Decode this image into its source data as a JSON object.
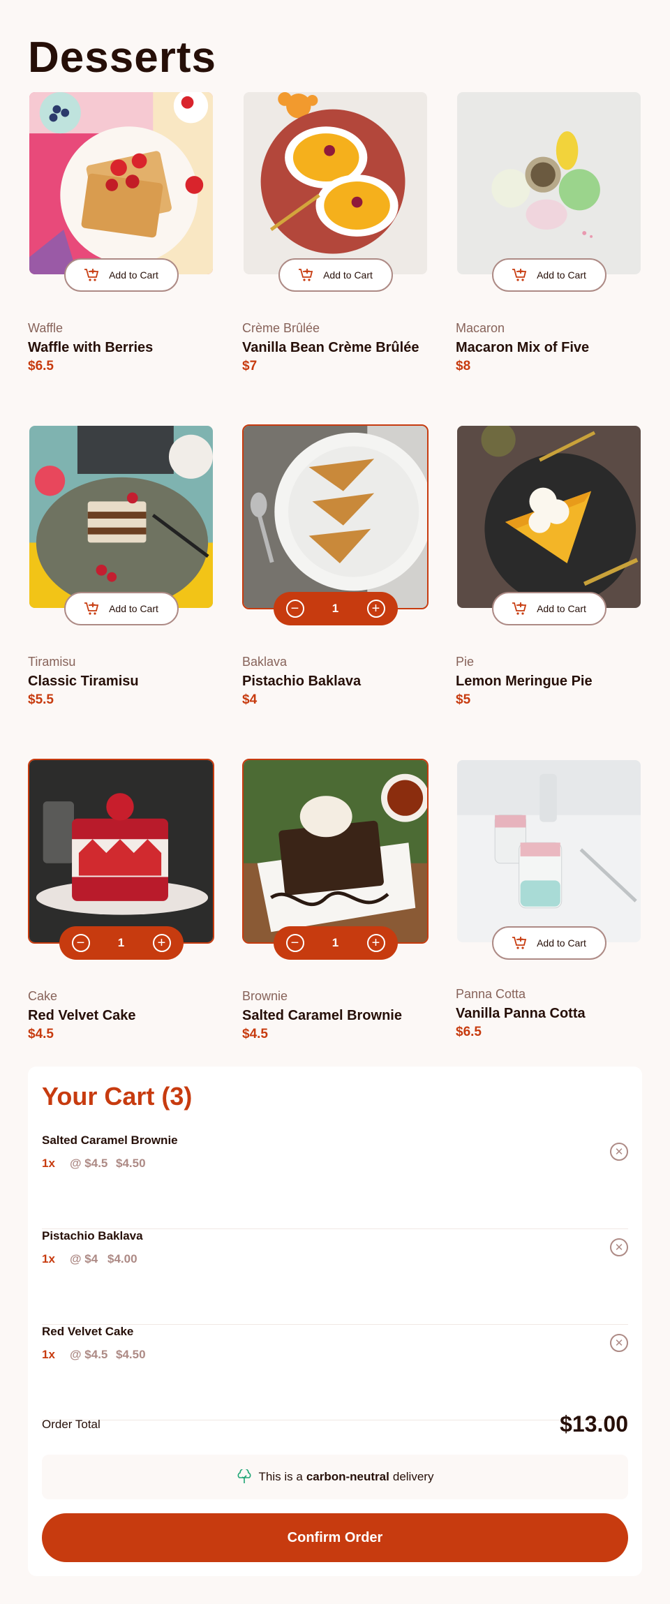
{
  "title": "Desserts",
  "add_to_cart_label": "Add to Cart",
  "colors": {
    "accent": "#c73b0f",
    "text": "#260f08",
    "muted": "#87635a",
    "background": "#fcf8f6"
  },
  "products": [
    {
      "category": "Waffle",
      "name": "Waffle with Berries",
      "price": "$6.5",
      "in_cart": false,
      "image_icon": "waffle-image"
    },
    {
      "category": "Crème Brûlée",
      "name": "Vanilla Bean Crème Brûlée",
      "price": "$7",
      "in_cart": false,
      "image_icon": "creme-brulee-image"
    },
    {
      "category": "Macaron",
      "name": "Macaron Mix of Five",
      "price": "$8",
      "in_cart": false,
      "image_icon": "macaron-image"
    },
    {
      "category": "Tiramisu",
      "name": "Classic Tiramisu",
      "price": "$5.5",
      "in_cart": false,
      "image_icon": "tiramisu-image"
    },
    {
      "category": "Baklava",
      "name": "Pistachio Baklava",
      "price": "$4",
      "in_cart": true,
      "quantity": "1",
      "image_icon": "baklava-image"
    },
    {
      "category": "Pie",
      "name": "Lemon Meringue Pie",
      "price": "$5",
      "in_cart": false,
      "image_icon": "pie-image"
    },
    {
      "category": "Cake",
      "name": "Red Velvet Cake",
      "price": "$4.5",
      "in_cart": true,
      "quantity": "1",
      "image_icon": "cake-image"
    },
    {
      "category": "Brownie",
      "name": "Salted Caramel Brownie",
      "price": "$4.5",
      "in_cart": true,
      "quantity": "1",
      "image_icon": "brownie-image"
    },
    {
      "category": "Panna Cotta",
      "name": "Vanilla Panna Cotta",
      "price": "$6.5",
      "in_cart": false,
      "image_icon": "panna-cotta-image"
    }
  ],
  "cart": {
    "title": "Your Cart (3)",
    "items": [
      {
        "name": "Salted Caramel Brownie",
        "qty": "1x",
        "unit": "@ $4.5",
        "total": "$4.50"
      },
      {
        "name": "Pistachio Baklava",
        "qty": "1x",
        "unit": "@ $4",
        "total": "$4.00"
      },
      {
        "name": "Red Velvet Cake",
        "qty": "1x",
        "unit": "@ $4.5",
        "total": "$4.50"
      }
    ],
    "order_total_label": "Order Total",
    "order_total": "$13.00",
    "carbon_prefix": "This is a",
    "carbon_bold": "carbon-neutral",
    "carbon_suffix": "delivery",
    "confirm_label": "Confirm Order"
  }
}
